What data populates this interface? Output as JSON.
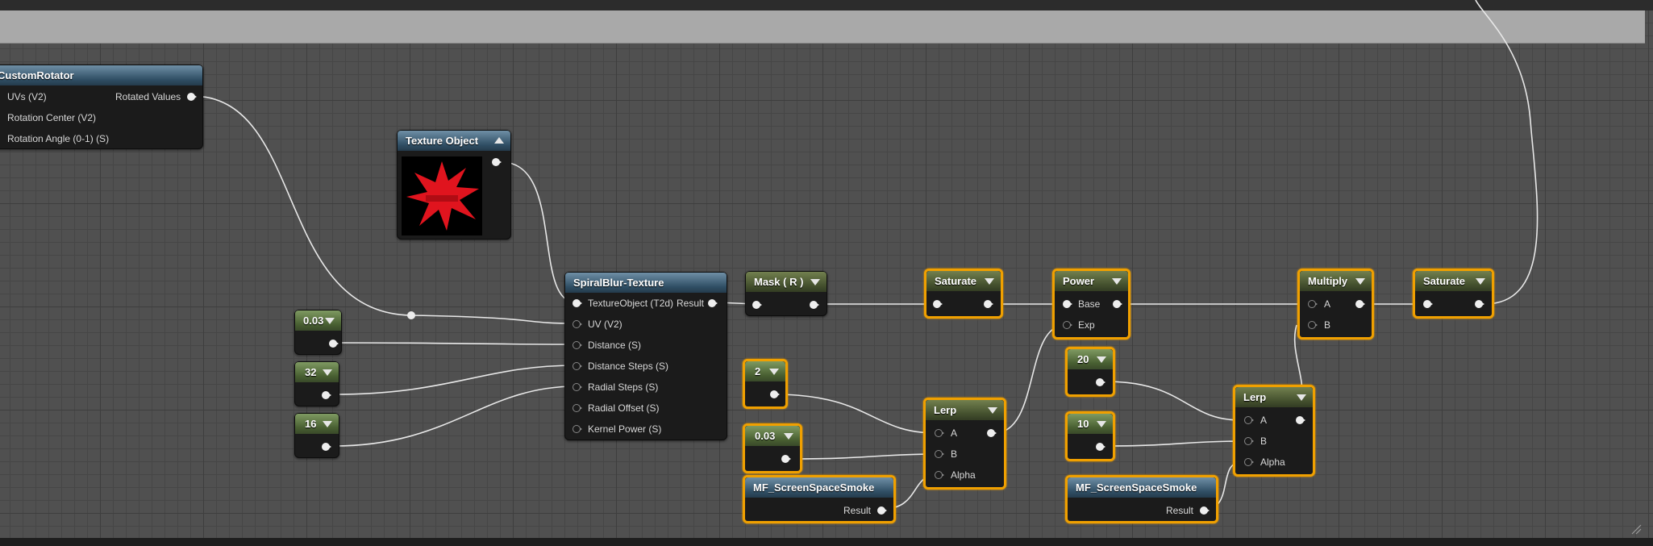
{
  "nodes": {
    "custom_rotator": {
      "title": "CustomRotator",
      "inputs": [
        "UVs (V2)",
        "Rotation Center (V2)",
        "Rotation Angle (0-1) (S)"
      ],
      "output": "Rotated Values"
    },
    "texture_object": {
      "title": "Texture Object",
      "thumbnail_color": "#e0141e"
    },
    "spiral_blur": {
      "title": "SpiralBlur-Texture",
      "inputs": [
        "TextureObject (T2d)",
        "UV (V2)",
        "Distance (S)",
        "Distance Steps (S)",
        "Radial Steps (S)",
        "Radial Offset (S)",
        "Kernel Power (S)"
      ],
      "output": "Result"
    },
    "const_003_left": {
      "title": "0.03"
    },
    "const_32": {
      "title": "32"
    },
    "const_16": {
      "title": "16"
    },
    "mask_r": {
      "title": "Mask ( R )"
    },
    "saturate_1": {
      "title": "Saturate"
    },
    "power": {
      "title": "Power",
      "inputs": [
        "Base",
        "Exp"
      ]
    },
    "multiply": {
      "title": "Multiply",
      "inputs": [
        "A",
        "B"
      ]
    },
    "saturate_2": {
      "title": "Saturate"
    },
    "const_2": {
      "title": "2"
    },
    "const_003_mid": {
      "title": "0.03"
    },
    "lerp_1": {
      "title": "Lerp",
      "inputs": [
        "A",
        "B",
        "Alpha"
      ]
    },
    "mf_smoke_1": {
      "title": "MF_ScreenSpaceSmoke",
      "output": "Result"
    },
    "const_20": {
      "title": "20"
    },
    "const_10": {
      "title": "10"
    },
    "lerp_2": {
      "title": "Lerp",
      "inputs": [
        "A",
        "B",
        "Alpha"
      ]
    },
    "mf_smoke_2": {
      "title": "MF_ScreenSpaceSmoke",
      "output": "Result"
    }
  },
  "colors": {
    "selection": "#f0a000",
    "wire": "#e8e8e8",
    "comment_bar": "#a9a9a9"
  }
}
